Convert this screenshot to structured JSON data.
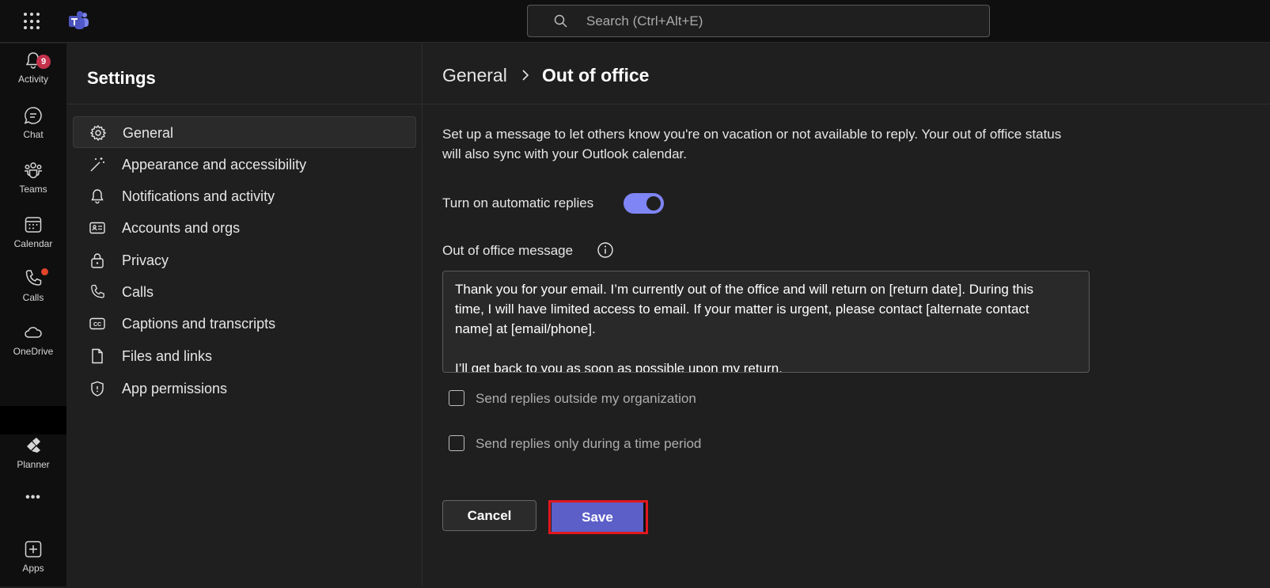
{
  "search": {
    "placeholder": "Search (Ctrl+Alt+E)"
  },
  "rail": {
    "activity": {
      "label": "Activity",
      "badge": "9"
    },
    "chat": {
      "label": "Chat"
    },
    "teams": {
      "label": "Teams"
    },
    "calendar": {
      "label": "Calendar"
    },
    "calls": {
      "label": "Calls"
    },
    "onedrive": {
      "label": "OneDrive"
    },
    "planner": {
      "label": "Planner"
    },
    "more": {
      "label": "•••"
    },
    "apps": {
      "label": "Apps"
    }
  },
  "settings": {
    "title": "Settings",
    "items": [
      {
        "label": "General",
        "icon": "gear-icon",
        "active": true
      },
      {
        "label": "Appearance and accessibility",
        "icon": "wand-icon"
      },
      {
        "label": "Notifications and activity",
        "icon": "bell-icon"
      },
      {
        "label": "Accounts and orgs",
        "icon": "id-card-icon"
      },
      {
        "label": "Privacy",
        "icon": "lock-icon"
      },
      {
        "label": "Calls",
        "icon": "phone-icon"
      },
      {
        "label": "Captions and transcripts",
        "icon": "cc-icon"
      },
      {
        "label": "Files and links",
        "icon": "file-icon"
      },
      {
        "label": "App permissions",
        "icon": "shield-icon"
      }
    ]
  },
  "main": {
    "breadcrumb": {
      "parent": "General",
      "current": "Out of office"
    },
    "description_line1": "Set up a message to let others know you're on vacation or not available to reply. Your out of office status",
    "description_line2": "will also sync with your Outlook calendar.",
    "toggle": {
      "label": "Turn on automatic replies",
      "on": true
    },
    "message": {
      "label": "Out of office message",
      "line1": "Thank you for your email. I’m currently out of the office and will return on [return date]. During this",
      "line2": "time, I will have limited access to email. If your matter is urgent, please contact [alternate contact",
      "line3": "name] at [email/phone].",
      "line4": "I’ll get back to you as soon as possible upon my return."
    },
    "checkbox_outside": {
      "label": "Send replies outside my organization",
      "checked": false
    },
    "checkbox_period": {
      "label": "Send replies only during a time period",
      "checked": false
    },
    "cancel_label": "Cancel",
    "save_label": "Save"
  },
  "colors": {
    "accent": "#5b5fc7",
    "toggle": "#7f85f5",
    "highlight": "#e1171e"
  }
}
